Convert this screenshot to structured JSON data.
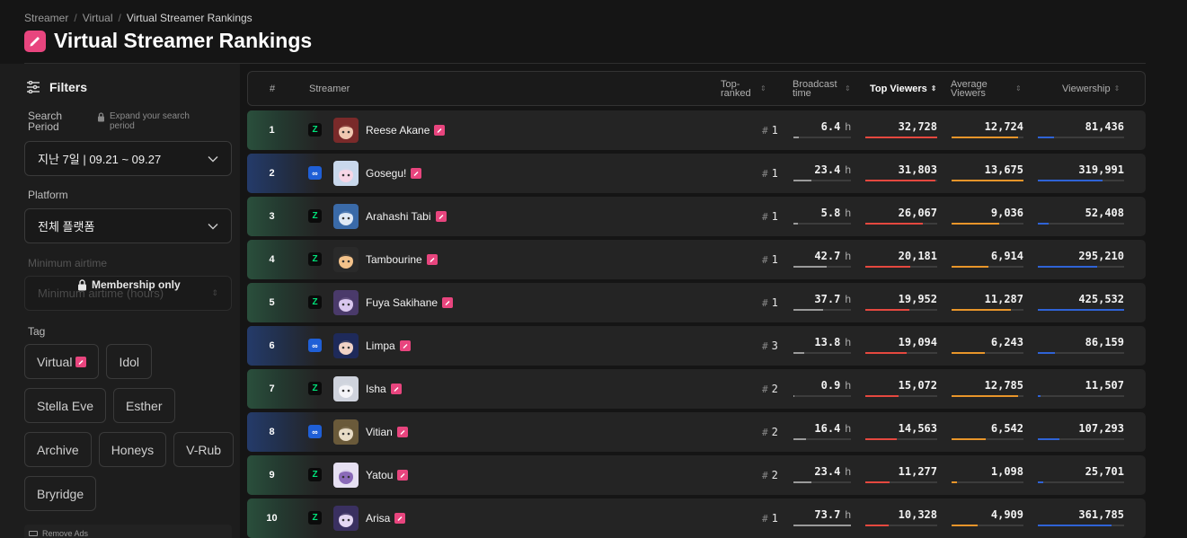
{
  "breadcrumb": [
    "Streamer",
    "Virtual",
    "Virtual Streamer Rankings"
  ],
  "page_title": "Virtual Streamer Rankings",
  "sidebar": {
    "filters_title": "Filters",
    "search_period_label": "Search Period",
    "expand_note": "Expand your search period",
    "period_value": "지난 7일 | 09.21 ~ 09.27",
    "platform_label": "Platform",
    "platform_value": "전체 플랫폼",
    "min_airtime_label": "Minimum airtime",
    "min_airtime_placeholder": "Minimum airtime (hours)",
    "membership_lock": "Membership only",
    "tag_label": "Tag",
    "tags": [
      "Virtual",
      "Idol",
      "Stella Eve",
      "Esther",
      "Archive",
      "Honeys",
      "V-Rub",
      "Bryridge"
    ],
    "remove_ads": "Remove Ads"
  },
  "table": {
    "headers": {
      "rank": "#",
      "streamer": "Streamer",
      "top_ranked": "Top-ranked",
      "broadcast_time": "Broadcast time",
      "top_viewers": "Top Viewers",
      "average_viewers": "Average Viewers",
      "viewership": "Viewership"
    },
    "hours_unit": "h",
    "rank_prefix": "#",
    "colors": {
      "chzzk": "#00e37a",
      "soop": "#1f5fd6",
      "top_viewers_bar": "#e5483f",
      "avg_viewers_bar": "#e8952a",
      "viewership_bar": "#2f63d6",
      "broadcast_bar": "#9a9a9a",
      "virtual_badge": "#e8457e"
    },
    "rows": [
      {
        "rank": "1",
        "platform": "chzzk",
        "name": "Reese Akane",
        "top_ranked": "1",
        "broadcast": "6.4",
        "top_viewers": "32,728",
        "avg_viewers": "12,724",
        "viewership": "81,436",
        "bt_frac": 0.09,
        "tv_frac": 1.0,
        "av_frac": 0.93,
        "vw_frac": 0.19
      },
      {
        "rank": "2",
        "platform": "soop",
        "name": "Gosegu!",
        "top_ranked": "1",
        "broadcast": "23.4",
        "top_viewers": "31,803",
        "avg_viewers": "13,675",
        "viewership": "319,991",
        "bt_frac": 0.32,
        "tv_frac": 0.97,
        "av_frac": 1.0,
        "vw_frac": 0.75
      },
      {
        "rank": "3",
        "platform": "chzzk",
        "name": "Arahashi Tabi",
        "top_ranked": "1",
        "broadcast": "5.8",
        "top_viewers": "26,067",
        "avg_viewers": "9,036",
        "viewership": "52,408",
        "bt_frac": 0.08,
        "tv_frac": 0.8,
        "av_frac": 0.66,
        "vw_frac": 0.12
      },
      {
        "rank": "4",
        "platform": "chzzk",
        "name": "Tambourine",
        "top_ranked": "1",
        "broadcast": "42.7",
        "top_viewers": "20,181",
        "avg_viewers": "6,914",
        "viewership": "295,210",
        "bt_frac": 0.58,
        "tv_frac": 0.62,
        "av_frac": 0.51,
        "vw_frac": 0.69
      },
      {
        "rank": "5",
        "platform": "chzzk",
        "name": "Fuya Sakihane",
        "top_ranked": "1",
        "broadcast": "37.7",
        "top_viewers": "19,952",
        "avg_viewers": "11,287",
        "viewership": "425,532",
        "bt_frac": 0.51,
        "tv_frac": 0.61,
        "av_frac": 0.83,
        "vw_frac": 1.0
      },
      {
        "rank": "6",
        "platform": "soop",
        "name": "Limpa",
        "top_ranked": "3",
        "broadcast": "13.8",
        "top_viewers": "19,094",
        "avg_viewers": "6,243",
        "viewership": "86,159",
        "bt_frac": 0.19,
        "tv_frac": 0.58,
        "av_frac": 0.46,
        "vw_frac": 0.2
      },
      {
        "rank": "7",
        "platform": "chzzk",
        "name": "Isha",
        "top_ranked": "2",
        "broadcast": "0.9",
        "top_viewers": "15,072",
        "avg_viewers": "12,785",
        "viewership": "11,507",
        "bt_frac": 0.01,
        "tv_frac": 0.46,
        "av_frac": 0.93,
        "vw_frac": 0.03
      },
      {
        "rank": "8",
        "platform": "soop",
        "name": "Vitian",
        "top_ranked": "2",
        "broadcast": "16.4",
        "top_viewers": "14,563",
        "avg_viewers": "6,542",
        "viewership": "107,293",
        "bt_frac": 0.22,
        "tv_frac": 0.44,
        "av_frac": 0.48,
        "vw_frac": 0.25
      },
      {
        "rank": "9",
        "platform": "chzzk",
        "name": "Yatou",
        "top_ranked": "2",
        "broadcast": "23.4",
        "top_viewers": "11,277",
        "avg_viewers": "1,098",
        "viewership": "25,701",
        "bt_frac": 0.32,
        "tv_frac": 0.34,
        "av_frac": 0.08,
        "vw_frac": 0.06
      },
      {
        "rank": "10",
        "platform": "chzzk",
        "name": "Arisa",
        "top_ranked": "1",
        "broadcast": "73.7",
        "top_viewers": "10,328",
        "avg_viewers": "4,909",
        "viewership": "361,785",
        "bt_frac": 1.0,
        "tv_frac": 0.32,
        "av_frac": 0.36,
        "vw_frac": 0.85
      }
    ]
  }
}
